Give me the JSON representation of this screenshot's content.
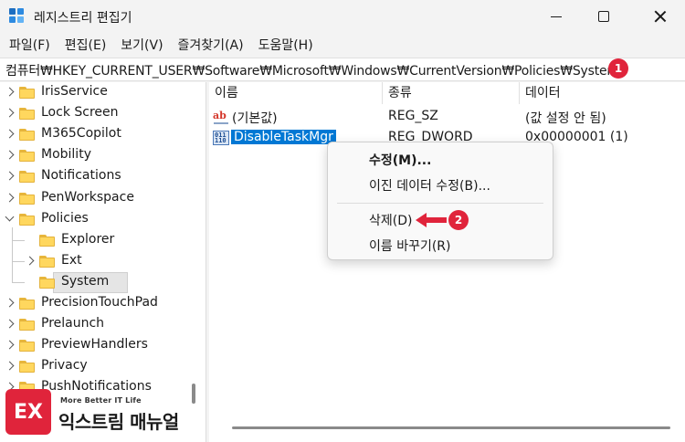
{
  "window": {
    "title": "레지스트리 편집기",
    "menu": [
      "파일(F)",
      "편집(E)",
      "보기(V)",
      "즐겨찾기(A)",
      "도움말(H)"
    ]
  },
  "address": {
    "path": "컴퓨터₩HKEY_CURRENT_USER₩Software₩Microsoft₩Windows₩CurrentVersion₩Policies₩System",
    "step_badge": "1"
  },
  "tree": {
    "items": [
      {
        "label": "IrisService",
        "expand": "right",
        "selected": false
      },
      {
        "label": "Lock Screen",
        "expand": "right",
        "selected": false
      },
      {
        "label": "M365Copilot",
        "expand": "right",
        "selected": false
      },
      {
        "label": "Mobility",
        "expand": "right",
        "selected": false
      },
      {
        "label": "Notifications",
        "expand": "right",
        "selected": false
      },
      {
        "label": "PenWorkspace",
        "expand": "right",
        "selected": false
      },
      {
        "label": "Policies",
        "expand": "down",
        "selected": false
      },
      {
        "label": "Explorer",
        "expand": "none",
        "selected": false
      },
      {
        "label": "Ext",
        "expand": "right",
        "selected": false
      },
      {
        "label": "System",
        "expand": "none",
        "selected": true
      },
      {
        "label": "PrecisionTouchPad",
        "expand": "right",
        "selected": false
      },
      {
        "label": "Prelaunch",
        "expand": "right",
        "selected": false
      },
      {
        "label": "PreviewHandlers",
        "expand": "right",
        "selected": false
      },
      {
        "label": "Privacy",
        "expand": "right",
        "selected": false
      },
      {
        "label": "PushNotifications",
        "expand": "right",
        "selected": false
      }
    ]
  },
  "values": {
    "headers": {
      "name": "이름",
      "type": "종류",
      "data": "데이터"
    },
    "rows": [
      {
        "icon": "string-value-icon",
        "icon_text": "ab",
        "name": "(기본값)",
        "type": "REG_SZ",
        "data": "(값 설정 안 됨)"
      },
      {
        "icon": "binary-value-icon",
        "icon_text": "011\n110",
        "name": "DisableTaskMgr",
        "type": "REG_DWORD",
        "data": "0x00000001 (1)"
      }
    ]
  },
  "context_menu": {
    "items": [
      "수정(M)...",
      "이진 데이터 수정(B)...",
      "삭제(D)",
      "이름 바꾸기(R)"
    ],
    "step_badge": "2"
  },
  "watermark": {
    "logo_text": "EX",
    "tagline": "More Better IT Life",
    "name": "익스트림 매뉴얼"
  },
  "colors": {
    "accent": "#0078d4",
    "badge": "#e0243b",
    "folder": "#ffd75e"
  }
}
